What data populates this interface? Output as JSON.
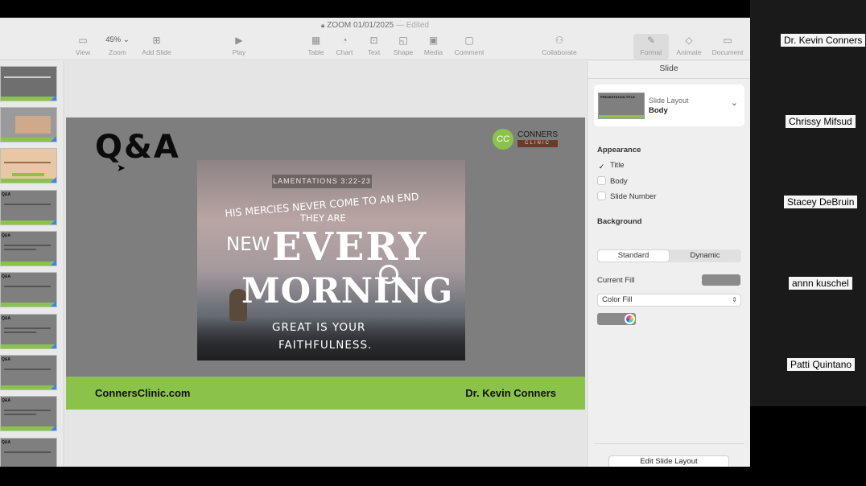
{
  "window": {
    "title": "ZOOM 01/01/2025",
    "edited": "— Edited"
  },
  "toolbar": {
    "view": "View",
    "zoom_value": "45%",
    "zoom": "Zoom",
    "add_slide": "Add Slide",
    "play": "Play",
    "table": "Table",
    "chart": "Chart",
    "text": "Text",
    "shape": "Shape",
    "media": "Media",
    "comment": "Comment",
    "collaborate": "Collaborate",
    "format": "Format",
    "animate": "Animate",
    "document": "Document"
  },
  "navigator": {
    "thumbs": [
      {
        "label": ""
      },
      {
        "label": ""
      },
      {
        "label": ""
      },
      {
        "label": "Q&A"
      },
      {
        "label": "Q&A"
      },
      {
        "label": "Q&A"
      },
      {
        "label": "Q&A"
      },
      {
        "label": "Q&A"
      },
      {
        "label": "Q&A"
      },
      {
        "label": "Q&A"
      }
    ]
  },
  "slide": {
    "title": "Q&A",
    "logo_name": "CONNERS",
    "logo_sub": "CLINIC",
    "logo_initials": "CC",
    "image_text": {
      "banner": "LAMENTATIONS 3:22-23",
      "line1": "HIS MERCIES NEVER COME TO AN END",
      "line2": "THEY ARE",
      "line3": "NEW",
      "line4": "EVERY",
      "line5": "MORNING",
      "line6": "GREAT IS YOUR",
      "line7": "FAITHFULNESS."
    },
    "footer_left": "ConnersClinic.com",
    "footer_right": "Dr. Kevin Conners"
  },
  "inspector": {
    "title": "Slide",
    "layout_label": "Slide Layout",
    "layout_value": "Body",
    "appearance": "Appearance",
    "chk_title": "Title",
    "chk_body": "Body",
    "chk_slide_number": "Slide Number",
    "background": "Background",
    "seg_standard": "Standard",
    "seg_dynamic": "Dynamic",
    "current_fill": "Current Fill",
    "fill_type": "Color Fill",
    "edit_layout": "Edit Slide Layout",
    "mini_title": "PRESENTATION TITLE"
  },
  "participants": [
    {
      "name": "Dr. Kevin Conners"
    },
    {
      "name": "Chrissy Mifsud"
    },
    {
      "name": "Stacey DeBruin"
    },
    {
      "name": "annn kuschel"
    },
    {
      "name": "Patti Quintano"
    }
  ],
  "colors": {
    "accent_green": "#8bc34a",
    "slide_gray": "#7e7e7e",
    "selection_blue": "#3b82f6"
  }
}
